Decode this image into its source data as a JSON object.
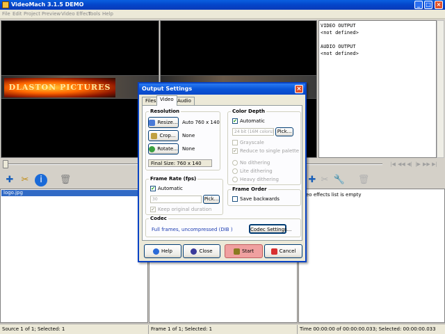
{
  "window": {
    "title": "VideoMach 3.1.5 DEMO"
  },
  "menu": [
    "File",
    "Edit",
    "Project",
    "Preview",
    "Video Effect",
    "Tools",
    "Help"
  ],
  "logo_text": "DLASTON PICTURES",
  "output_panel": {
    "video_header": "VIDEO OUTPUT",
    "video_value": "<not defined>",
    "audio_header": "AUDIO OUTPUT",
    "audio_value": "<not defined>"
  },
  "source_list": {
    "items": [
      "logo.jpg"
    ]
  },
  "effects_list": {
    "empty_text": "eo effects list is empty"
  },
  "status": {
    "source": "Source 1 of 1;   Selected: 1",
    "frame": "Frame 1 of 1;   Selected: 1",
    "time": "Time 00:00:00 of 00:00:00.033;   Selected: 00:00:00.033"
  },
  "dialog": {
    "title": "Output Settings",
    "tabs": [
      "Files",
      "Video",
      "Audio"
    ],
    "active_tab": "Video",
    "resolution": {
      "label": "Resolution",
      "resize_label": "Resize...",
      "resize_value": "Auto 760 x 140",
      "crop_label": "Crop...",
      "crop_value": "None",
      "rotate_label": "Rotate...",
      "rotate_value": "None",
      "final_size": "Final Size:  760 x 140"
    },
    "color_depth": {
      "label": "Color Depth",
      "automatic_label": "Automatic",
      "automatic_checked": true,
      "depth_value": "24 bit (16M colors)",
      "pick_label": "Pick...",
      "grayscale_label": "Grayscale",
      "reduce_label": "Reduce to single palette",
      "no_dither_label": "No dithering",
      "lite_dither_label": "Lite dithering",
      "heavy_dither_label": "Heavy dithering"
    },
    "frame_rate": {
      "label": "Frame Rate (fps)",
      "automatic_label": "Automatic",
      "automatic_checked": true,
      "value": "30",
      "pick_label": "Pick...",
      "keep_label": "Keep original duration"
    },
    "frame_order": {
      "label": "Frame Order",
      "save_backwards_label": "Save backwards",
      "save_backwards_checked": false
    },
    "codec": {
      "label": "Codec",
      "value": "Full frames, uncompressed  (DIB )",
      "settings_label": "Codec Settings..."
    },
    "buttons": {
      "help": "Help",
      "close": "Close",
      "start": "Start",
      "cancel": "Cancel"
    }
  },
  "colors": {
    "titlebar": "#0a55d8",
    "selection": "#316ac5",
    "start_button": "#f0a0a0"
  }
}
